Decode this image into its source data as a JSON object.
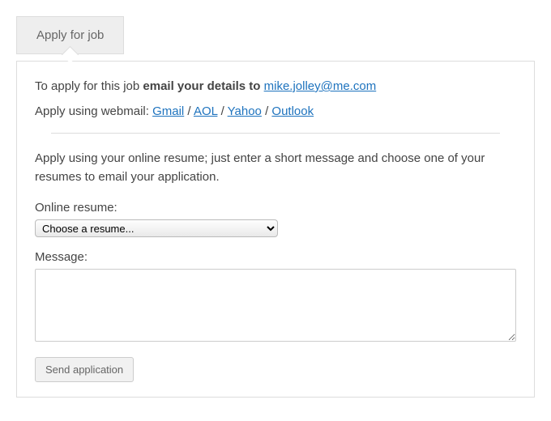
{
  "tab": {
    "label": "Apply for job"
  },
  "intro": {
    "prefix": "To apply for this job ",
    "bold": "email your details to ",
    "email": "mike.jolley@me.com"
  },
  "webmail": {
    "prefix": "Apply using webmail: ",
    "links": {
      "gmail": "Gmail",
      "aol": "AOL",
      "yahoo": "Yahoo",
      "outlook": "Outlook"
    },
    "sep": " / "
  },
  "resume_intro": "Apply using your online resume; just enter a short message and choose one of your resumes to email your application.",
  "labels": {
    "online_resume": "Online resume:",
    "message": "Message:"
  },
  "resume_select": {
    "placeholder": "Choose a resume..."
  },
  "buttons": {
    "send": "Send application"
  }
}
